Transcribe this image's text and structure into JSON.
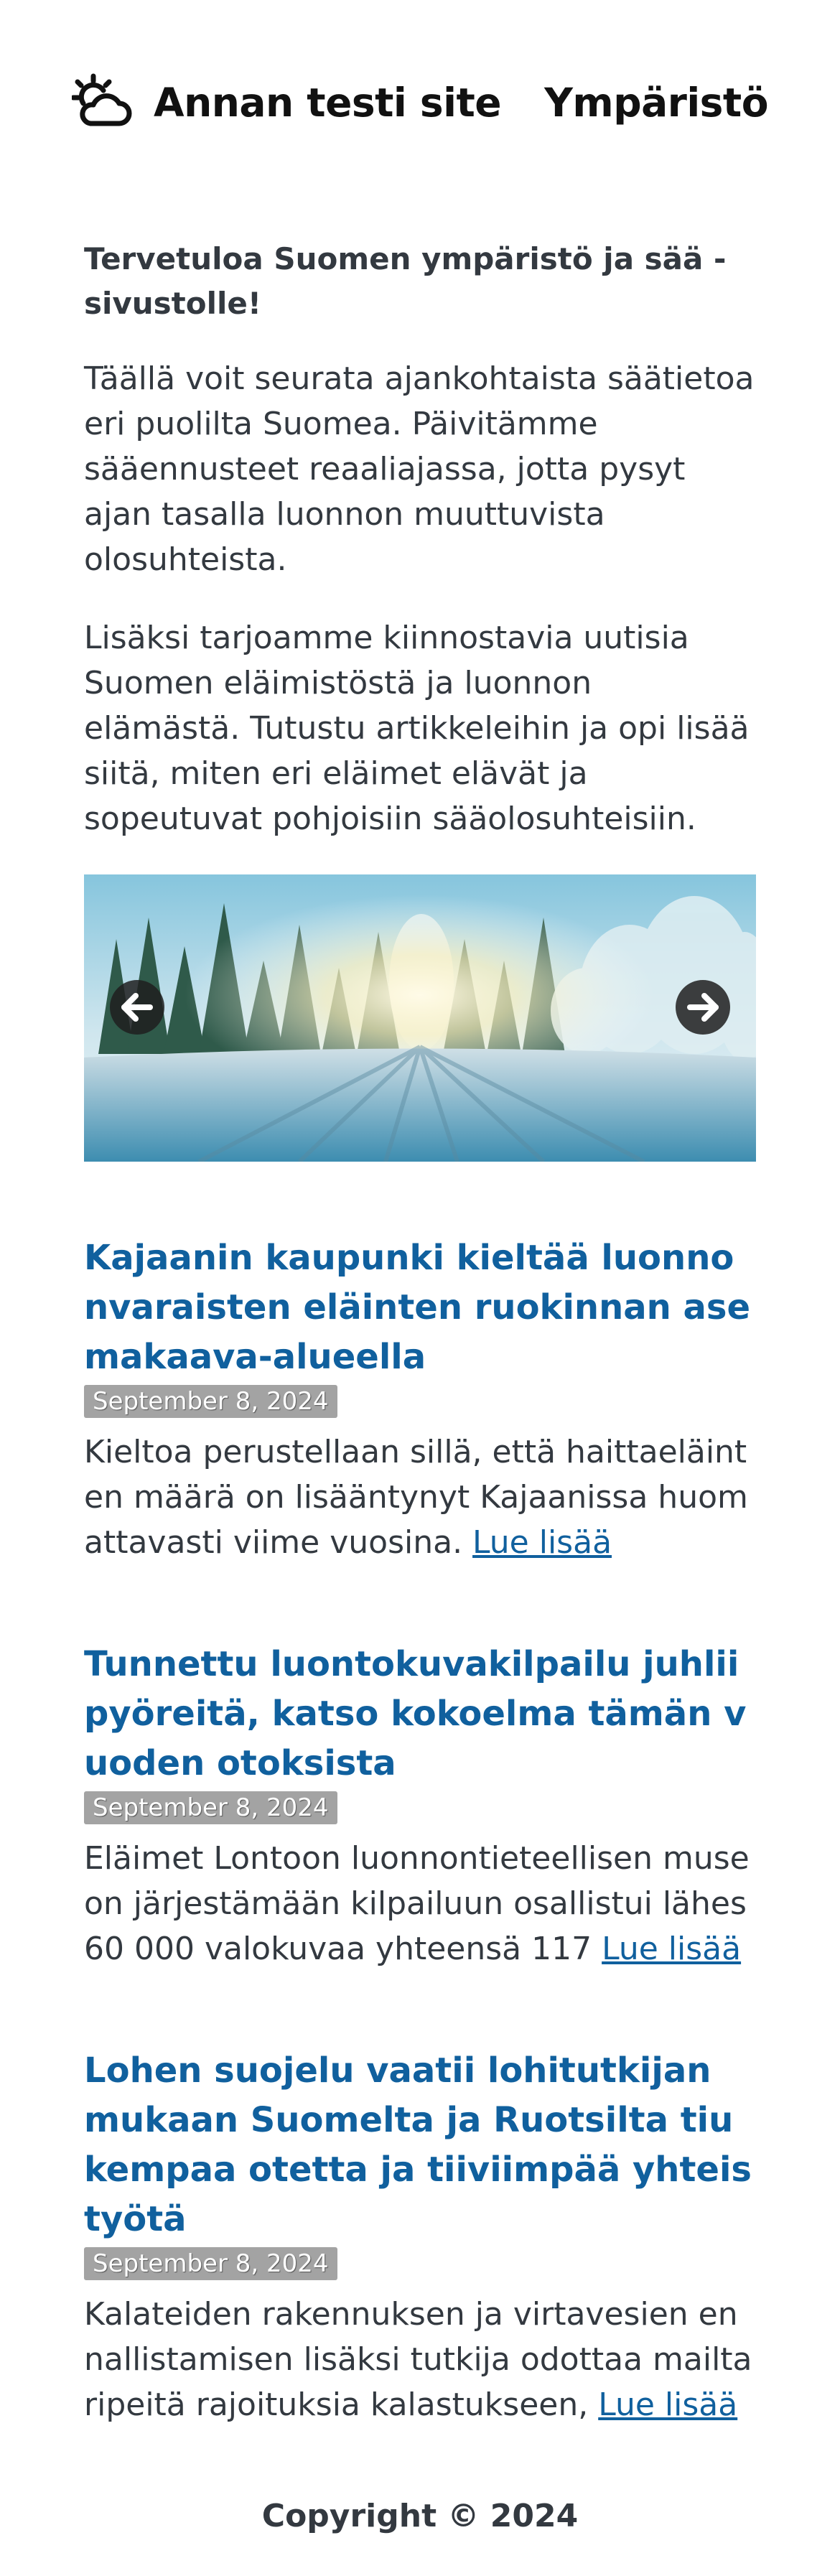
{
  "header": {
    "site_title": "Annan testi site",
    "nav_link": "Ympäristö",
    "logo_icon": "sun-cloud-icon"
  },
  "intro": {
    "heading": "Tervetuloa Suomen ympäristö ja sää -sivustolle!",
    "paragraph_1": "Täällä voit seurata ajankohtaista säätietoa eri puolilta Suomea. Päivitämme sääennusteet reaaliajassa, jotta pysyt ajan tasalla luonnon muuttuvista olosuhteista.",
    "paragraph_2": "Lisäksi tarjoamme kiinnostavia uutisia Suomen eläimistöstä ja luonnon elämästä. Tutustu artikkeleihin ja opi lisää siitä, miten eri eläimet elävät ja sopeutuvat pohjoisiin sääolosuhteisiin."
  },
  "carousel": {
    "prev_icon": "arrow-left-icon",
    "next_icon": "arrow-right-icon"
  },
  "articles": [
    {
      "title": "Kajaanin kaupunki kieltää luonnonvaraisten eläinten ruokinnan asemakaava-alueella",
      "date": "September 8, 2024",
      "summary": "Kieltoa perustellaan sillä, että haittaeläinten määrä on lisääntynyt Kajaanissa huomattavasti viime vuosina. ",
      "more": "Lue lisää"
    },
    {
      "title": "Tunnettu luontokuvakilpailu juhlii pyöreitä, katso kokoelma tämän vuoden otoksista",
      "date": "September 8, 2024",
      "summary": "Eläimet Lontoon luonnontieteellisen museon järjestämään kilpailuun osallistui lähes 60 000 valokuvaa yhteensä 117 ",
      "more": "Lue lisää"
    },
    {
      "title": "Lohen suojelu vaatii lohitutkijan mukaan Suomelta ja Ruotsilta tiukempaa otetta ja tiiviimpää yhteistyötä",
      "date": "September 8, 2024",
      "summary": "Kalateiden rakennuksen ja virtavesien ennallistamisen lisäksi tutkija odottaa mailta ripeitä rajoituksia kalastukseen, ",
      "more": "Lue lisää"
    }
  ],
  "footer": {
    "copyright": "Copyright © 2024"
  }
}
